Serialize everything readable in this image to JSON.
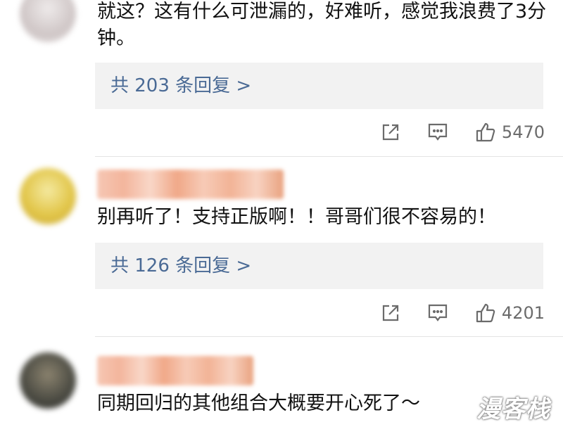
{
  "comments": [
    {
      "text": "就这？这有什么可泄漏的，好难听，感觉我浪费了3分钟。",
      "reply_link": "共 203 条回复 >",
      "like_count": "5470",
      "avatar_color": "#d8d0d0"
    },
    {
      "text": "别再听了！支持正版啊！！哥哥们很不容易的！",
      "reply_link": "共 126 条回复 >",
      "like_count": "4201",
      "avatar_color": "#e2c64a"
    },
    {
      "text": "同期回归的其他组合大概要开心死了～",
      "avatar_color": "#4a4a42"
    }
  ],
  "icons": {
    "share": "share-icon",
    "comment": "comment-icon",
    "like": "thumbs-up-icon"
  },
  "watermark": "漫客栈"
}
